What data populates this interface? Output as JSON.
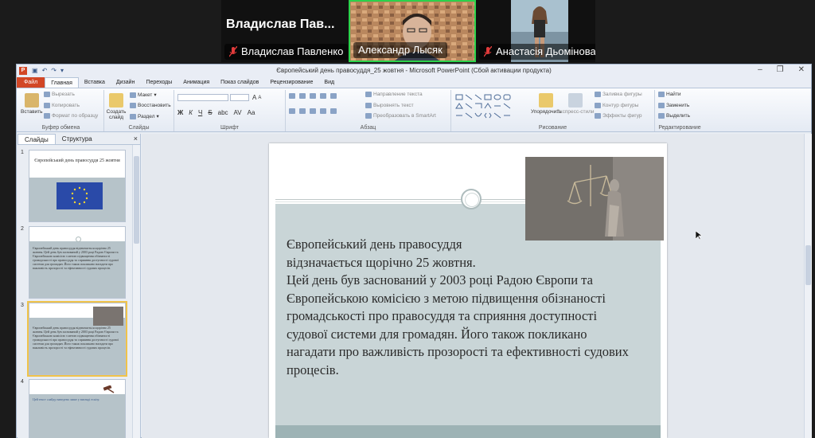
{
  "call": {
    "tile1_name": "Владислав  Пав...",
    "tile1_label": "Владислав Павленко",
    "tile2_label": "Александр Лысяк",
    "tile3_label": "Анастасія Дьомінова"
  },
  "window": {
    "title": "Європейський день правосуддя_25 жовтня - Microsoft PowerPoint (Сбой активации продукта)",
    "app_icon": "P"
  },
  "tabs": [
    "Файл",
    "Главная",
    "Вставка",
    "Дизайн",
    "Переходы",
    "Анимация",
    "Показ слайдов",
    "Рецензирование",
    "Вид"
  ],
  "ribbon": {
    "clipboard": {
      "paste": "Вставить",
      "cut": "Вырезать",
      "copy": "Копировать",
      "format": "Формат по образцу",
      "label": "Буфер обмена"
    },
    "slides": {
      "new": "Создать слайд",
      "layout": "Макет",
      "reset": "Восстановить",
      "section": "Раздел",
      "label": "Слайды"
    },
    "font": {
      "label": "Шрифт",
      "bold": "Ж",
      "italic": "К",
      "underline": "Ч",
      "strike": "S",
      "abc": "abc",
      "spacing": "AV",
      "case": "Aa",
      "grow": "A",
      "shrink": "A"
    },
    "paragraph": {
      "dir": "Направление текста",
      "align": "Выровнять текст",
      "smartart": "Преобразовать в SmartArt",
      "label": "Абзац"
    },
    "drawing": {
      "arrange": "Упорядочить",
      "styles": "Экспресс-стили",
      "fill": "Заливка фигуры",
      "outline": "Контур фигуры",
      "effects": "Эффекты фигур",
      "label": "Рисование"
    },
    "editing": {
      "find": "Найти",
      "replace": "Заменить",
      "select": "Выделить",
      "label": "Редактирование"
    }
  },
  "leftpane": {
    "tab_slides": "Слайды",
    "tab_outline": "Структура",
    "close": "×",
    "thumbs": [
      {
        "num": "1",
        "title": "Європейський день правосуддя 25 жовтня"
      },
      {
        "num": "2",
        "text": "Європейський день правосуддя відзначається щорічно 25 жовтня. Цей день був заснований у 2003 році Радою Європи та Європейською комісією з метою підвищення обізнаності громадськості про правосуддя та сприяння доступності судової системи для громадян. Його також покликано нагадати про важливість прозорості та ефективності судових процесів."
      },
      {
        "num": "3",
        "text": "Європейський день правосуддя відзначається щорічно 25 жовтня. Цей день був заснований у 2003 році Радою Європи та Європейською комісією з метою підвищення обізнаності громадськості про правосуддя та сприяння доступності судової системи для громадян. Його також покликано нагадати про важливість прозорості та ефективності судових процесів."
      },
      {
        "num": "4",
        "text": "Цей текст слайду наведено лише у вигляді ескізу."
      }
    ]
  },
  "slide": {
    "p1": "Європейський день правосуддя відзначається щорічно 25 жовтня.",
    "p2": "Цей день був заснований у 2003 році Радою Європи та Європейською комісією з метою підвищення обізнаності громадськості про правосуддя та сприяння доступності судової системи для громадян. Його також покликано нагадати про важливість прозорості та ефективності судових процесів."
  },
  "colors": {
    "active_speaker": "#2bd24b",
    "file_tab": "#d24726",
    "slide_band": "#c9d5d7",
    "selected_thumb": "#f0c34a"
  }
}
